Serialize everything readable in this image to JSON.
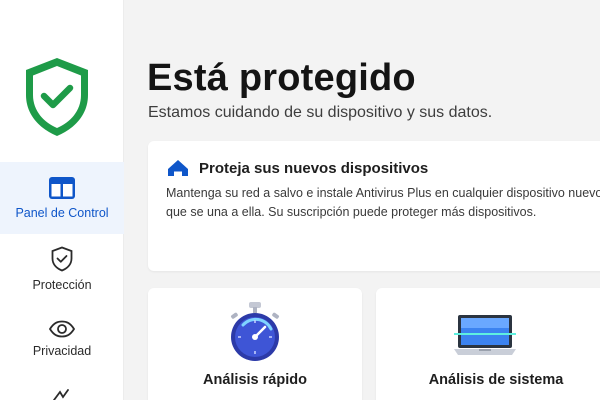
{
  "sidebar": {
    "items": [
      {
        "label": "Panel de Control",
        "icon": "dashboard-icon",
        "active": true
      },
      {
        "label": "Protección",
        "icon": "shield-check-icon",
        "active": false
      },
      {
        "label": "Privacidad",
        "icon": "eye-icon",
        "active": false
      },
      {
        "label": "",
        "icon": "more-icon",
        "active": false
      }
    ]
  },
  "main": {
    "title": "Está protegido",
    "subtitle": "Estamos cuidando de su dispositivo y sus datos."
  },
  "promo": {
    "title": "Proteja sus nuevos dispositivos",
    "text": "Mantenga su red a salvo e instale Antivirus Plus en cualquier dispositivo nuevo que se una a ella. Su suscripción puede proteger más dispositivos."
  },
  "cards": {
    "quick_scan": {
      "label": "Análisis rápido"
    },
    "system_scan": {
      "label": "Análisis de sistema"
    }
  },
  "colors": {
    "accent": "#0f56c9",
    "shield_green": "#1e9b48",
    "active_bg": "#eef4fd"
  }
}
